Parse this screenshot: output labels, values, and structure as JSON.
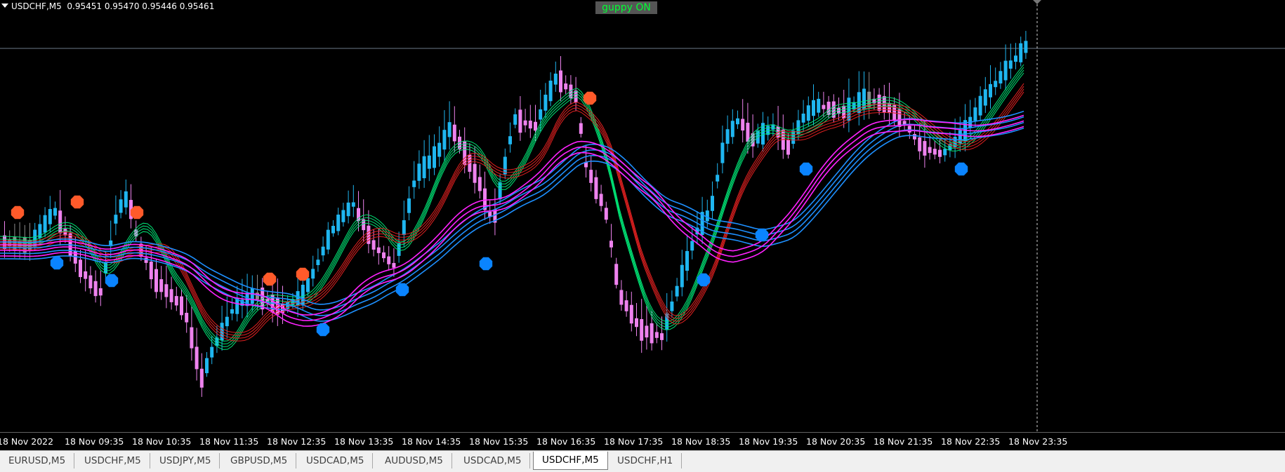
{
  "chart": {
    "header": {
      "symbol": "USDCHF,M5",
      "quotes": "0.95451 0.95470 0.95446 0.95461"
    },
    "badge": "guppy ON",
    "time_labels": [
      "18 Nov 2022",
      "18 Nov 09:35",
      "18 Nov 10:35",
      "18 Nov 11:35",
      "18 Nov 12:35",
      "18 Nov 13:35",
      "18 Nov 14:35",
      "18 Nov 15:35",
      "18 Nov 16:35",
      "18 Nov 17:35",
      "18 Nov 18:35",
      "18 Nov 19:35",
      "18 Nov 20:35",
      "18 Nov 21:35",
      "18 Nov 22:35",
      "18 Nov 23:35"
    ],
    "colors": {
      "background": "#000000",
      "bull_candle": "#1fb6f0",
      "bear_candle": "#ee82ee",
      "neutral_candle": "#8c8c8c",
      "short_ema_up": "#00e676",
      "short_ema_down": "#e02020",
      "long_ema_up": "#1e90ff",
      "long_ema_down": "#ff22ff",
      "sell_signal": "#ff5a2a",
      "buy_signal": "#0a84ff",
      "price_line": "#6c7a8a"
    }
  },
  "tabs": [
    {
      "label": "EURUSD,M5",
      "active": false
    },
    {
      "label": "USDCHF,M5",
      "active": false
    },
    {
      "label": "USDJPY,M5",
      "active": false
    },
    {
      "label": "GBPUSD,M5",
      "active": false
    },
    {
      "label": "USDCAD,M5",
      "active": false
    },
    {
      "label": "AUDUSD,M5",
      "active": false
    },
    {
      "label": "USDCAD,M5",
      "active": false
    },
    {
      "label": "USDCHF,M5",
      "active": true
    },
    {
      "label": "USDCHF,H1",
      "active": false
    }
  ]
}
